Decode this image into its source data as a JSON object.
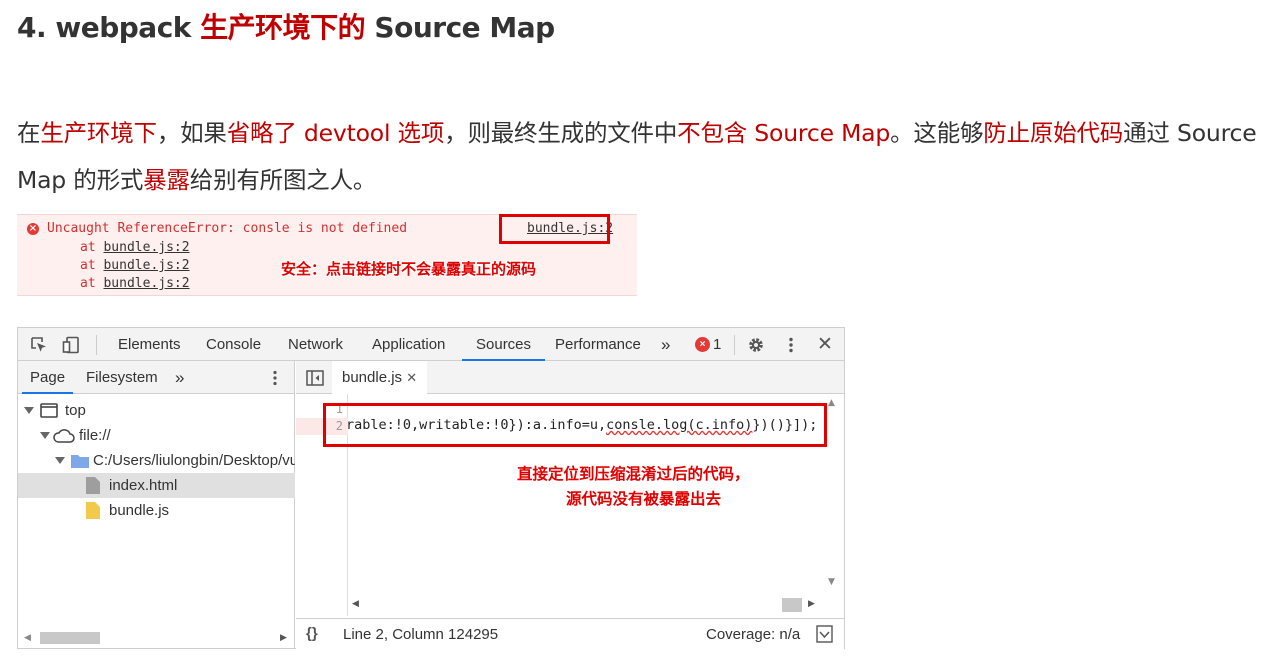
{
  "heading": {
    "prefix": "4. webpack ",
    "highlight": "生产环境下的",
    "suffix": " Source Map"
  },
  "paragraph": {
    "segments": [
      {
        "text": "在",
        "hl": false
      },
      {
        "text": "生产环境下",
        "hl": true
      },
      {
        "text": "，如果",
        "hl": false
      },
      {
        "text": "省略了 devtool 选项",
        "hl": true
      },
      {
        "text": "，则最终生成的文件中",
        "hl": false
      },
      {
        "text": "不包含 Source Map",
        "hl": true
      },
      {
        "text": "。这能够",
        "hl": false
      },
      {
        "text": "防止原始代码",
        "hl": true
      },
      {
        "text": "通过 Source Map 的形式",
        "hl": false
      },
      {
        "text": "暴露",
        "hl": true
      },
      {
        "text": "给别有所图之人。",
        "hl": false
      }
    ]
  },
  "console_error": {
    "icon": "error-x-icon",
    "message": "Uncaught ReferenceError: consle is not defined",
    "source_link": "bundle.js:2",
    "stack": [
      {
        "at": "at",
        "link": "bundle.js:2"
      },
      {
        "at": "at",
        "link": "bundle.js:2"
      },
      {
        "at": "at",
        "link": "bundle.js:2"
      }
    ],
    "annotation": "安全：点击链接时不会暴露真正的源码"
  },
  "devtools": {
    "tabs": [
      "Elements",
      "Console",
      "Network",
      "Application",
      "Sources",
      "Performance"
    ],
    "active_tab": "Sources",
    "more_tabs": "»",
    "error_count": "1",
    "close": "✕",
    "navigator_tabs": [
      "Page",
      "Filesystem"
    ],
    "navigator_more": "»",
    "tree": [
      {
        "label": "top",
        "icon": "window-icon"
      },
      {
        "label": "file://",
        "icon": "cloud-icon"
      },
      {
        "label": "C:/Users/liulongbin/Desktop/vu",
        "icon": "folder-icon"
      },
      {
        "label": "index.html",
        "icon": "file-icon"
      },
      {
        "label": "bundle.js",
        "icon": "js-file-icon"
      }
    ],
    "open_file": "bundle.js",
    "open_file_close": "✕",
    "line_numbers": [
      "1",
      "2"
    ],
    "code_line": {
      "before": "rable:!0,writable:!0}):a.info=u,",
      "error_part": "consle.log(c.info)",
      "after": "})()}]);"
    },
    "annotation_line1": "直接定位到压缩混淆过后的代码，",
    "annotation_line2": "源代码没有被暴露出去",
    "status": {
      "format_icon": "{}",
      "position": "Line 2, Column 124295",
      "coverage": "Coverage: n/a"
    }
  }
}
